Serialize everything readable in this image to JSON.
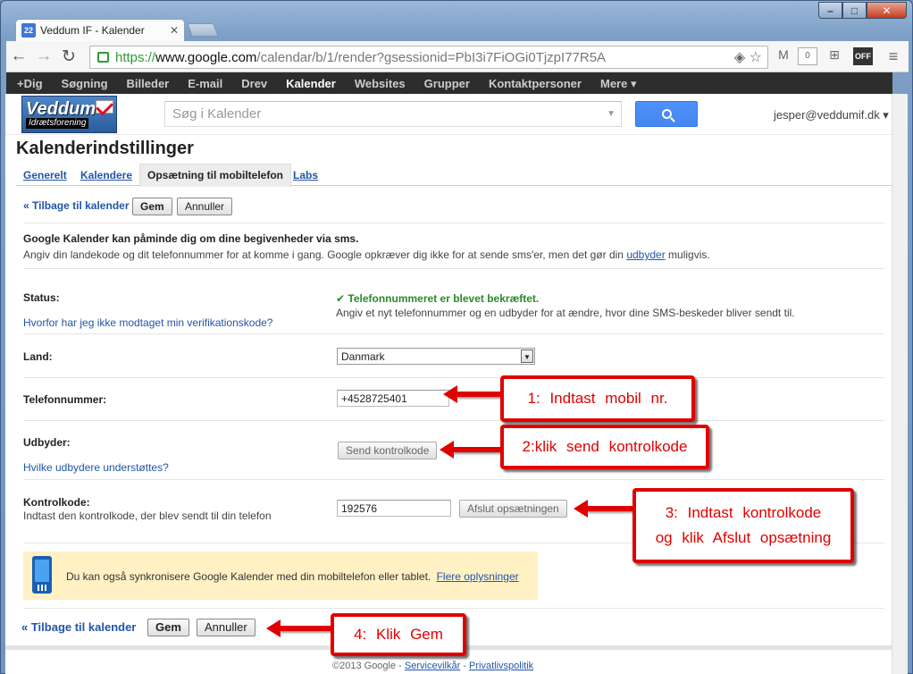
{
  "browser": {
    "tab_title": "Veddum IF - Kalender",
    "favicon_text": "22",
    "tab_close": "✕",
    "url_scheme": "https://",
    "url_host": "www.google.com",
    "url_path": "/calendar/b/1/render?gsessionid=PbI3i7FiOGi0TjzpI77R5A",
    "ext_badge": "0",
    "ext_off": "OFF"
  },
  "gbar": {
    "items": [
      "+Dig",
      "Søgning",
      "Billeder",
      "E-mail",
      "Drev",
      "Kalender",
      "Websites",
      "Grupper",
      "Kontaktpersoner",
      "Mere ▾"
    ],
    "active": "Kalender"
  },
  "header": {
    "logo_main": "Veddum",
    "logo_sub": "Idrætsforening",
    "search_placeholder": "Søg i Kalender",
    "user": "jesper@veddumif.dk ▾"
  },
  "page": {
    "title": "Kalenderindstillinger",
    "tabs": [
      "Generelt",
      "Kalendere",
      "Opsætning til mobiltelefon",
      "Labs"
    ],
    "back_link": "« Tilbage til kalender",
    "save": "Gem",
    "cancel": "Annuller",
    "intro_title": "Google Kalender kan påminde dig om dine begivenheder via sms.",
    "intro_text": "Angiv din landekode og dit telefonnummer for at komme i gang. Google opkræver dig ikke for at sende sms'er, men det gør din",
    "intro_link": "udbyder",
    "intro_end": "muligvis.",
    "status_label": "Status:",
    "status_help": "Hvorfor har jeg ikke modtaget min verifikationskode?",
    "status_ok": "Telefonnummeret er blevet bekræftet.",
    "status_ok_icon": "✔",
    "status_hint": "Angiv et nyt telefonnummer og en udbyder for at ændre, hvor dine SMS-beskeder bliver sendt til.",
    "country_label": "Land:",
    "country_value": "Danmark",
    "phone_label": "Telefonnummer:",
    "phone_value": "+4528725401",
    "carrier_label": "Udbyder:",
    "carrier_button": "Send kontrolkode",
    "carrier_help": "Hvilke udbydere understøttes?",
    "code_label": "Kontrolkode:",
    "code_help": "Indtast den kontrolkode, der blev sendt til din telefon",
    "code_value": "192576",
    "finish_button": "Afslut opsætningen",
    "banner_text": "Du kan også synkronisere Google Kalender med din mobiltelefon eller tablet.",
    "banner_link": "Flere oplysninger",
    "footer_copy": "©2013 Google -",
    "footer_terms": "Servicevilkår",
    "footer_sep": "-",
    "footer_privacy": "Privatlivspolitik"
  },
  "annotations": {
    "step1": "1:  Indtast  mobil  nr.",
    "step2": "2:klik  send  kontrolkode",
    "step3_line1": "3:  Indtast  kontrolkode",
    "step3_line2": "og  klik  Afslut  opsætning",
    "step4": "4:  Klik  Gem"
  }
}
